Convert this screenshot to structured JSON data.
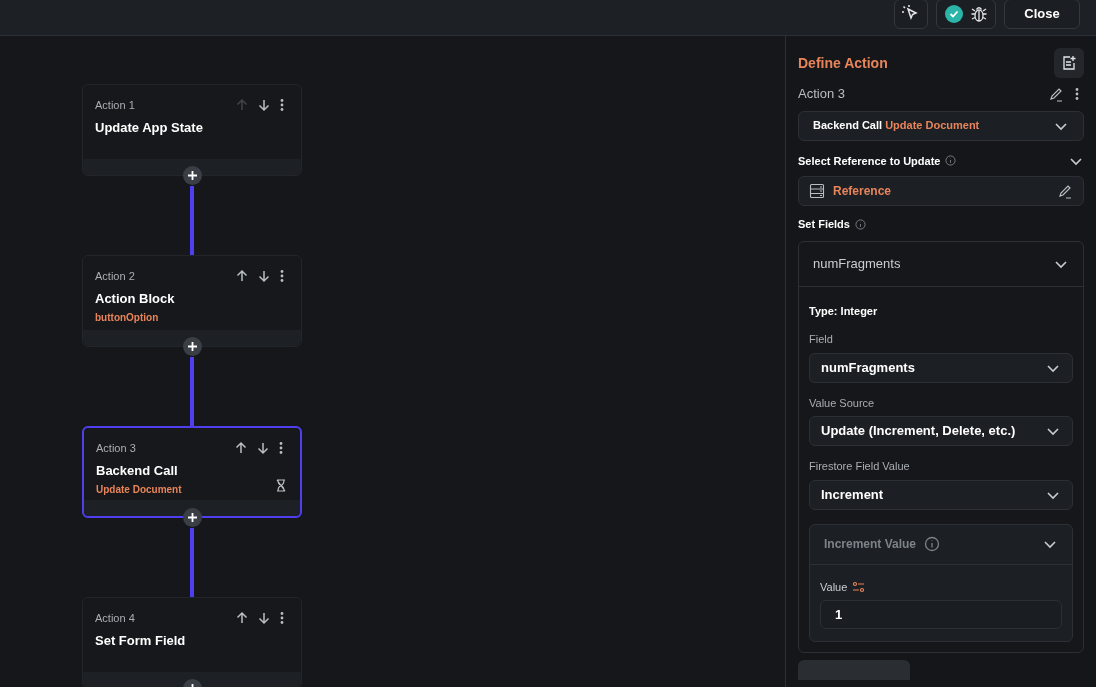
{
  "toolbar": {
    "close_label": "Close",
    "check_ok": true
  },
  "actions": [
    {
      "label": "Action 1",
      "title": "Update App State",
      "selected": false,
      "up_disabled": true,
      "pending": false
    },
    {
      "label": "Action 2",
      "title": "Action Block",
      "subtitle": "buttonOption",
      "selected": false,
      "up_disabled": false,
      "pending": false
    },
    {
      "label": "Action 3",
      "title": "Backend Call",
      "subtitle": "Update Document",
      "selected": true,
      "up_disabled": false,
      "pending": true
    },
    {
      "label": "Action 4",
      "title": "Set Form Field",
      "selected": false,
      "up_disabled": false,
      "pending": false
    }
  ],
  "panel": {
    "title": "Define Action",
    "action_label": "Action 3",
    "action_type": {
      "main": "Backend Call",
      "sub": "Update Document"
    },
    "reference_section": {
      "title": "Select Reference to Update",
      "expanded": true,
      "value": "Reference"
    },
    "set_fields": {
      "title": "Set Fields",
      "field_name": "numFragments",
      "expanded": true,
      "type_label": "Type: Integer",
      "dropdowns": [
        {
          "label": "Field",
          "value": "numFragments"
        },
        {
          "label": "Value Source",
          "value": "Update (Increment, Delete, etc.)"
        },
        {
          "label": "Firestore Field Value",
          "value": "Increment"
        }
      ],
      "increment": {
        "title": "Increment Value",
        "value_label": "Value",
        "value": "1"
      }
    }
  }
}
